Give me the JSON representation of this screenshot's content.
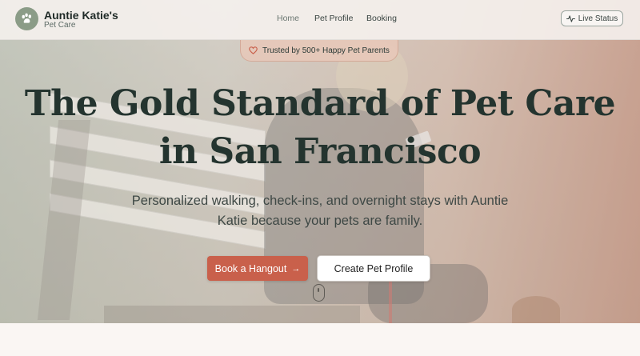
{
  "brand": {
    "name": "Auntie Katie's",
    "sub": "Pet Care",
    "logo_icon": "paw-icon"
  },
  "nav": {
    "links": [
      {
        "label": "Home"
      },
      {
        "label": "Pet Profile"
      },
      {
        "label": "Booking"
      }
    ],
    "live_status": {
      "label": "Live Status",
      "icon": "activity-icon"
    }
  },
  "hero": {
    "badge": {
      "label": "Trusted by 500+ Happy Pet Parents",
      "icon": "heart-icon"
    },
    "title_line1": "The Gold Standard of Pet Care",
    "title_line2": "in San Francisco",
    "subtitle_line1": "Personalized walking, check-ins, and overnight stays with Auntie",
    "subtitle_line2": "Katie because your pets are family.",
    "cta_primary": {
      "label": "Book a Hangout",
      "arrow": "→"
    },
    "cta_secondary": {
      "label": "Create Pet Profile"
    }
  },
  "colors": {
    "accent": "#c9604b",
    "brand": "#8b9c87",
    "text": "#24342f"
  }
}
